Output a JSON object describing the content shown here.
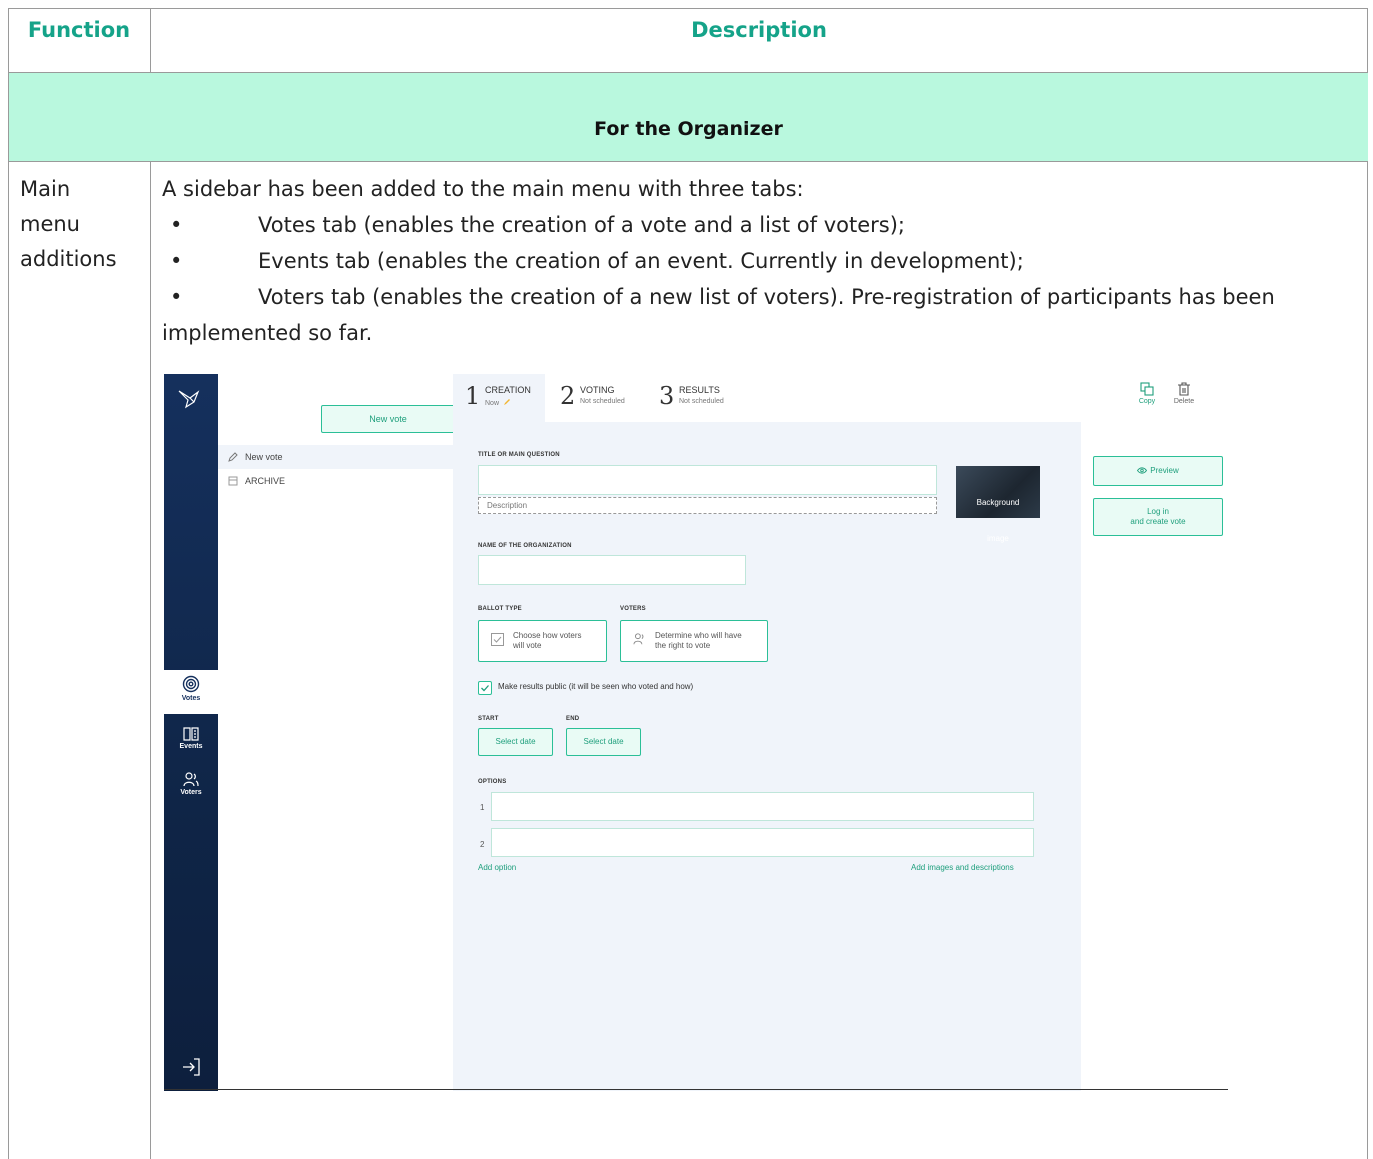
{
  "table": {
    "header_function": "Function",
    "header_description": "Description",
    "section_title": "For the Organizer",
    "row_function_lines": [
      "Main",
      "menu",
      "additions"
    ],
    "intro": "A sidebar has been added to the main menu with three tabs:",
    "bullets": [
      "Votes tab (enables the creation of a vote and a list of voters);",
      "Events tab (enables the creation of an event. Currently in development);",
      "Voters tab (enables the creation of a new list of voters). Pre-registration of participants has been"
    ],
    "continuation": "implemented so far.",
    "colors": {
      "header_text": "#15a389",
      "section_bg": "#b9f8de",
      "border": "#9a9a9a"
    }
  },
  "app": {
    "rail": {
      "nav": [
        {
          "label": "Votes",
          "icon": "target-icon",
          "active": true
        },
        {
          "label": "Events",
          "icon": "book-icon",
          "active": false
        },
        {
          "label": "Voters",
          "icon": "users-icon",
          "active": false
        }
      ],
      "exit_icon": "logout-icon",
      "colors": {
        "bg": "#15305d"
      }
    },
    "panel": {
      "new_vote_button": "New vote",
      "items": [
        {
          "label": "New vote",
          "icon": "pencil-icon"
        },
        {
          "label": "ARCHIVE",
          "icon": "archive-icon"
        }
      ]
    },
    "stepper": [
      {
        "num": "1",
        "label": "CREATION",
        "sub": "Now"
      },
      {
        "num": "2",
        "label": "VOTING",
        "sub": "Not scheduled"
      },
      {
        "num": "3",
        "label": "RESULTS",
        "sub": "Not scheduled"
      }
    ],
    "tools": {
      "copy": "Copy",
      "delete": "Delete"
    },
    "form": {
      "title_label": "TITLE OR MAIN QUESTION",
      "description_placeholder": "Description",
      "background_image": [
        "Background",
        "image"
      ],
      "org_label": "NAME OF THE ORGANIZATION",
      "ballot_label": "BALLOT TYPE",
      "voters_label": "VOTERS",
      "ballot_choice": [
        "Choose how voters",
        "will vote"
      ],
      "voters_choice": [
        "Determine who will have",
        "the right to vote"
      ],
      "public_results": "Make results public (it will be seen who voted and how)",
      "start_label": "START",
      "end_label": "END",
      "start_button": "Select date",
      "end_button": "Select date",
      "options_label": "OPTIONS",
      "option_numbers": [
        "1",
        "2"
      ],
      "add_option": "Add option",
      "add_images": "Add images and descriptions"
    },
    "actions": {
      "preview": "Preview",
      "login": [
        "Log in",
        "and create vote"
      ]
    },
    "colors": {
      "accent": "#2bbf97",
      "accent_text": "#1e9f7c",
      "form_bg": "#f0f4fa"
    }
  }
}
